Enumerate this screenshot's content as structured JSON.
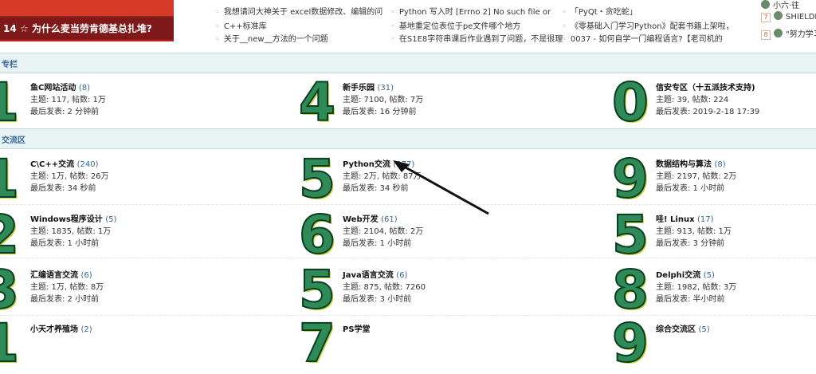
{
  "banner": {
    "caption": "14 ☆ 为什么麦当劳肯德基总扎堆?"
  },
  "news": [
    [
      "我想请问大神关于 excel数据修改、编辑的问",
      "C++标准库",
      "关于__new__方法的一个问题"
    ],
    [
      "Python 写入时 [Errno 2] No such file or",
      "基地重定位表位于pe文件哪个地方",
      "在S1E8字符串课后作业遇到了问题，不是很理"
    ],
    [
      "「PyQt・贪吃蛇」",
      "《零基础入门学习Python》配套书籍上架啦，",
      "0037 - 如何自学一门编程语言?【老司机的"
    ]
  ],
  "users": [
    {
      "rank": "",
      "name": "小六·往"
    },
    {
      "rank": "7",
      "name": "SHIELDM"
    },
    {
      "rank": "8",
      "name": "\"努力学习"
    }
  ],
  "sections": [
    {
      "title": "专栏"
    },
    {
      "title": "交流区"
    }
  ],
  "forums": [
    {
      "digit": "1",
      "name": "鱼C网站活动",
      "count": "(8)",
      "stats": "主题: 117, 帖数: 1万",
      "last": "最后发表: 2 分钟前"
    },
    {
      "digit": "4",
      "name": "新手乐园",
      "count": "(31)",
      "stats": "主题: 7100, 帖数: 7万",
      "last": "最后发表: 16 分钟前"
    },
    {
      "digit": "0",
      "name": "信安专区（十五派技术支持)",
      "count": "",
      "stats": "主题: 39, 帖数: 224",
      "last": "最后发表: 2019-2-18 17:39"
    },
    {
      "digit": "1",
      "name": "C\\C++交流",
      "count": "(240)",
      "stats": "主题: 1万, 帖数: 26万",
      "last": "最后发表: 34 秒前"
    },
    {
      "digit": "5",
      "name": "Python交流",
      "count": "(377)",
      "stats": "主题: 2万, 帖数: 87万",
      "last": "最后发表: 34 秒前"
    },
    {
      "digit": "9",
      "name": "数据结构与算法",
      "count": "(8)",
      "stats": "主题: 2197, 帖数: 2万",
      "last": "最后发表: 1 小时前"
    },
    {
      "digit": "2",
      "name": "Windows程序设计",
      "count": "(5)",
      "stats": "主题: 1835, 帖数: 1万",
      "last": "最后发表: 1 小时前"
    },
    {
      "digit": "6",
      "name": "Web开发",
      "count": "(61)",
      "stats": "主题: 2104, 帖数: 2万",
      "last": "最后发表: 1 小时前"
    },
    {
      "digit": "5",
      "name": "哇! Linux",
      "count": "(17)",
      "stats": "主题: 913, 帖数: 1万",
      "last": "最后发表: 3 分钟前"
    },
    {
      "digit": "3",
      "name": "汇编语言交流",
      "count": "(6)",
      "stats": "主题: 1万, 帖数: 8万",
      "last": "最后发表: 2 小时前"
    },
    {
      "digit": "5",
      "name": "Java语言交流",
      "count": "(6)",
      "stats": "主题: 875, 帖数: 7260",
      "last": "最后发表: 3 小时前"
    },
    {
      "digit": "8",
      "name": "Delphi交流",
      "count": "(5)",
      "stats": "主题: 1982, 帖数: 3万",
      "last": "最后发表: 半小时前"
    },
    {
      "digit": "1",
      "name": "小天才养殖场",
      "count": "(2)",
      "stats": "",
      "last": ""
    },
    {
      "digit": "7",
      "name": "PS学堂",
      "count": "",
      "stats": "",
      "last": ""
    },
    {
      "digit": "9",
      "name": "综合交流区",
      "count": "(5)",
      "stats": "",
      "last": ""
    }
  ],
  "colors": {
    "section_bg": "#e8f3f4",
    "section_text": "#336699",
    "count_text": "#336699",
    "digit_fill": "#2e8b57"
  }
}
